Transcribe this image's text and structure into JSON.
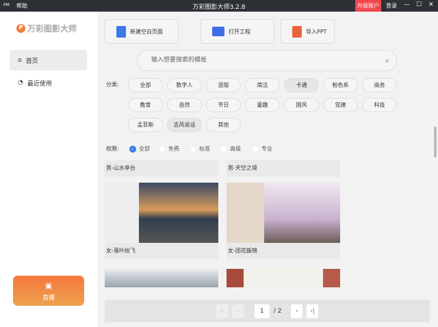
{
  "titlebar": {
    "pm": "PM",
    "help": "帮助",
    "title": "万彩图影大师3.2.8",
    "upgrade": "升级账户",
    "login": "登录",
    "minimize": "—",
    "maximize": "☐",
    "close": "✕"
  },
  "sidebar": {
    "logo": "万彩图影大师",
    "items": [
      {
        "label": "首页",
        "icon": "home-icon"
      },
      {
        "label": "最近使用",
        "icon": "clock-icon"
      }
    ],
    "live": "直播"
  },
  "toolbar": [
    {
      "label": "新建空白页面",
      "color": "#3b7be8"
    },
    {
      "label": "打开工程",
      "color": "#3f6fe6"
    },
    {
      "label": "导入PPT",
      "color": "#e8663f"
    }
  ],
  "search": {
    "placeholder": "输入想要搜索的模板"
  },
  "category": {
    "label": "分类:",
    "items": [
      "全部",
      "数字人",
      "竖版",
      "简洁",
      "卡通",
      "粉色系",
      "商务",
      "教育",
      "自然",
      "节日",
      "童趣",
      "国风",
      "党建",
      "科技",
      "孟菲斯",
      "古风说话",
      "其他"
    ],
    "selected": [
      "卡通",
      "古风说话"
    ]
  },
  "permission": {
    "label": "权限:",
    "options": [
      "全部",
      "免费",
      "标准",
      "高级",
      "专业"
    ],
    "selected": "全部"
  },
  "templates": [
    {
      "name": "男-山水亭台"
    },
    {
      "name": "男-天空之境"
    },
    {
      "name": "女-落叶纷飞"
    },
    {
      "name": "女-团花簇锦"
    }
  ],
  "pager": {
    "current": "1",
    "total": "/ 2"
  }
}
